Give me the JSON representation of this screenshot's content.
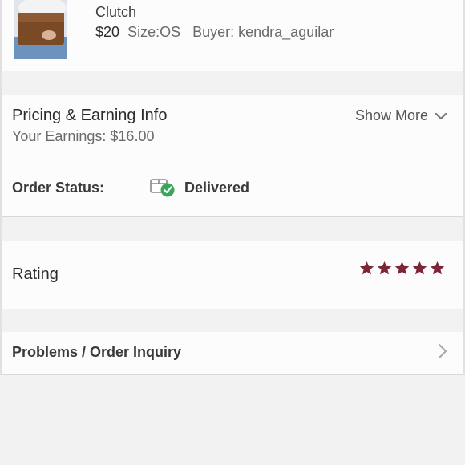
{
  "product": {
    "title": "Clutch",
    "price": "$20",
    "size": "Size:OS",
    "buyer": "Buyer: kendra_aguilar"
  },
  "pricing": {
    "title": "Pricing & Earning Info",
    "earnings": "Your Earnings: $16.00",
    "show_more": "Show More",
    "show_more_icon": "chevron-down-icon"
  },
  "order_status": {
    "label": "Order Status:",
    "icon": "package-delivered-icon",
    "value": "Delivered",
    "check_color": "#3aa65a"
  },
  "rating": {
    "label": "Rating",
    "stars": 5,
    "max_stars": 5,
    "star_color": "#7d2638"
  },
  "problems": {
    "label": "Problems / Order Inquiry",
    "icon": "chevron-right-icon"
  }
}
